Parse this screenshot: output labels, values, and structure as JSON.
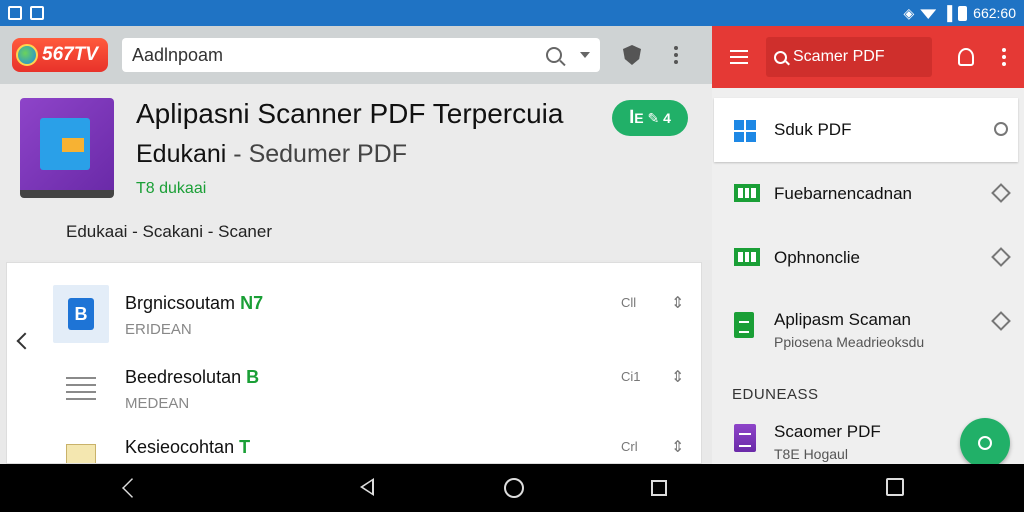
{
  "status_bar": {
    "time": "662:60"
  },
  "toolbar": {
    "brand": "567TV",
    "search_value": "Aadlnpoam"
  },
  "app": {
    "title": "Aplipasni Scanner PDF Terpercuia",
    "subtitle_main": "Edukani",
    "subtitle_dev": " - Sedumer PDF",
    "category": "T8 dukaai",
    "install_label": "ꟾE ✎ 4",
    "tags": "Edukaai - Scakani - Scaner"
  },
  "list": {
    "items": [
      {
        "title": "Brgnicsoutam",
        "mark": " N7",
        "sub": "ERIDEAN",
        "size": "Cll",
        "more": "⇕"
      },
      {
        "title": "Beedresolutan",
        "mark": " B",
        "sub": "MEDEAN",
        "size": "Ci1",
        "more": "⇕"
      },
      {
        "title": "Kesieocohtan",
        "mark": " T",
        "sub": "",
        "size": "Crl",
        "more": "⇕"
      }
    ]
  },
  "right_panel": {
    "search_label": "Scamer PDF",
    "menu": [
      {
        "label": "Sduk PDF",
        "sub": ""
      },
      {
        "label": "Fuebarnencadnan",
        "sub": ""
      },
      {
        "label": "Ophnonclie",
        "sub": ""
      },
      {
        "label": "Aplipasm Scaman",
        "sub": "Ppiosena Meadrieoksdu"
      },
      {
        "label": "Scaomer PDF",
        "sub": "T8E Hogaul"
      }
    ],
    "section_header": "EDUNEASS"
  }
}
